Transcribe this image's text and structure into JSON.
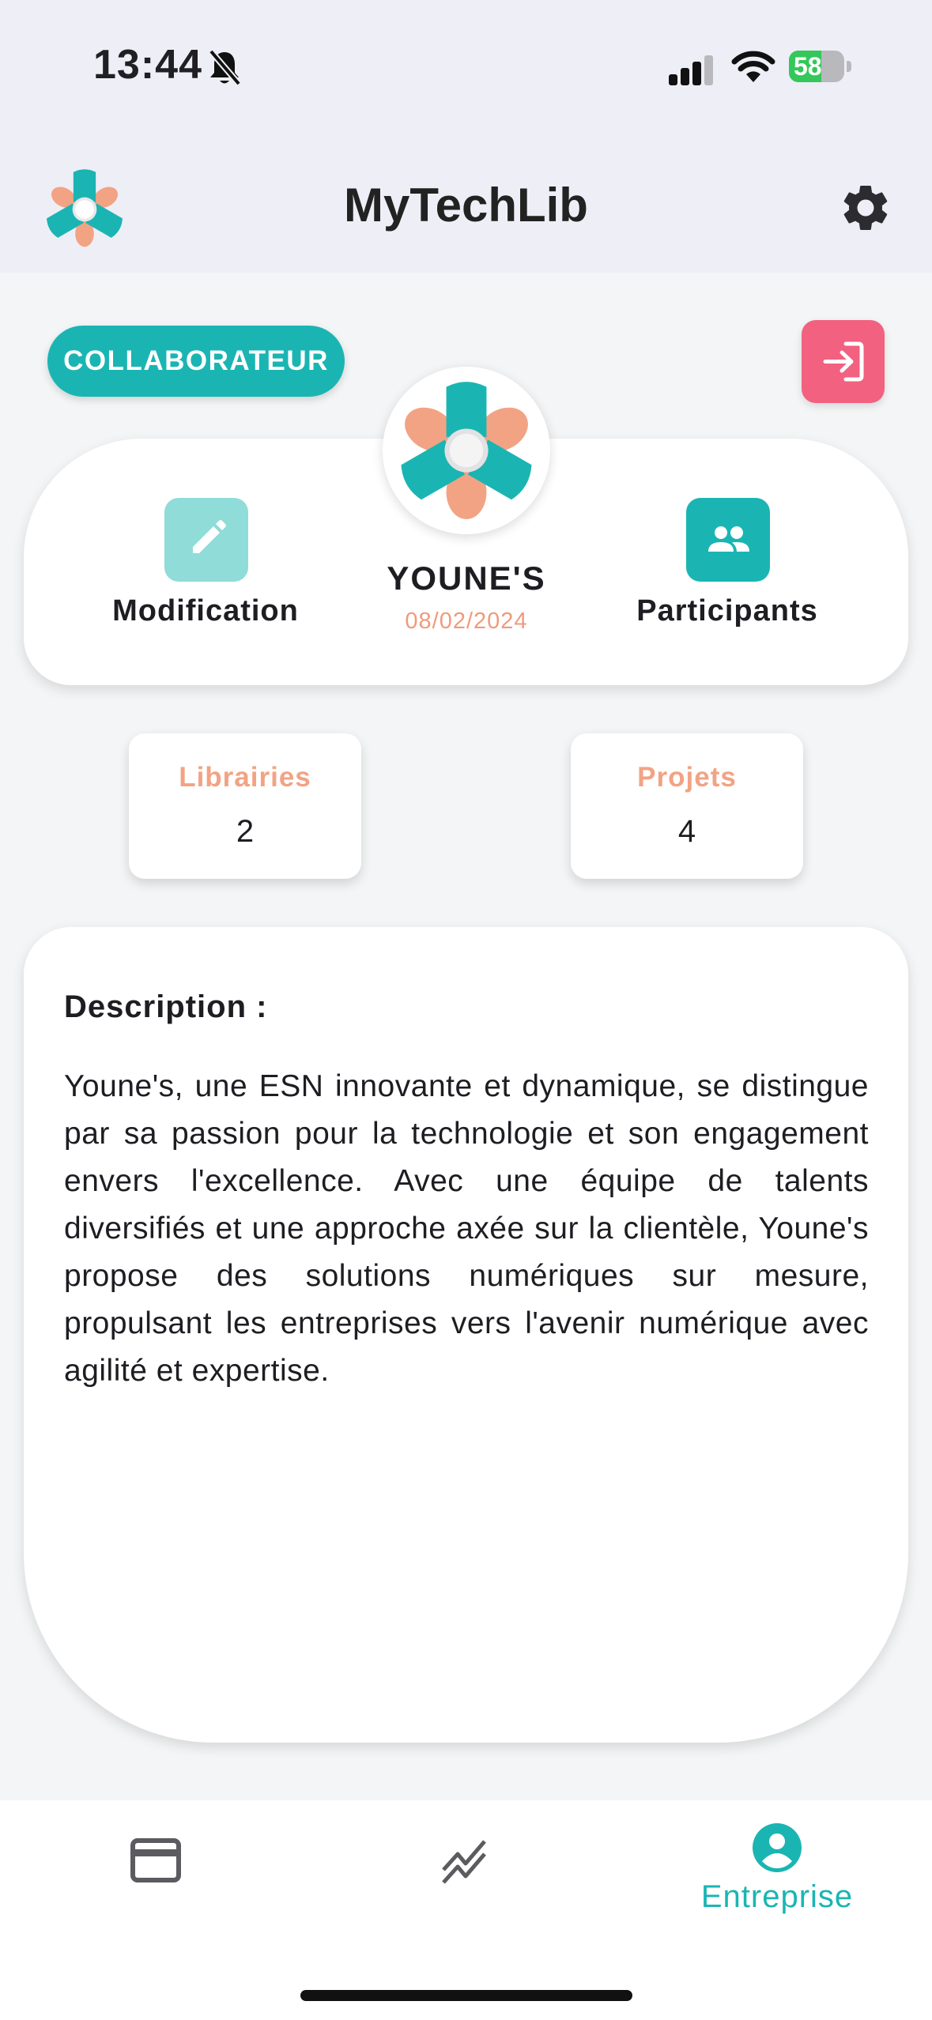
{
  "status_bar": {
    "time": "13:44",
    "battery": "58",
    "battery_level": 0.58
  },
  "header": {
    "title": "MyTechLib"
  },
  "role_badge": "COLLABORATEUR",
  "company": {
    "name": "YOUNE'S",
    "date": "08/02/2024"
  },
  "actions": {
    "edit_label": "Modification",
    "participants_label": "Participants"
  },
  "stats": [
    {
      "label": "Librairies",
      "value": "2"
    },
    {
      "label": "Projets",
      "value": "4"
    }
  ],
  "description": {
    "title": "Description :",
    "text": "Youne's, une ESN innovante et dynamique, se distingue par sa passion pour la technologie et son engagement envers l'excellence. Avec une équipe de talents diversifiés et une approche axée sur la clientèle, Youne's propose des solutions numériques sur mesure, propulsant les entreprises vers l'avenir numérique avec agilité et expertise."
  },
  "bottom_nav": {
    "active_label": "Entreprise"
  },
  "colors": {
    "accent": "#1ab5b3",
    "secondary": "#f2a384",
    "danger": "#f2617f"
  }
}
